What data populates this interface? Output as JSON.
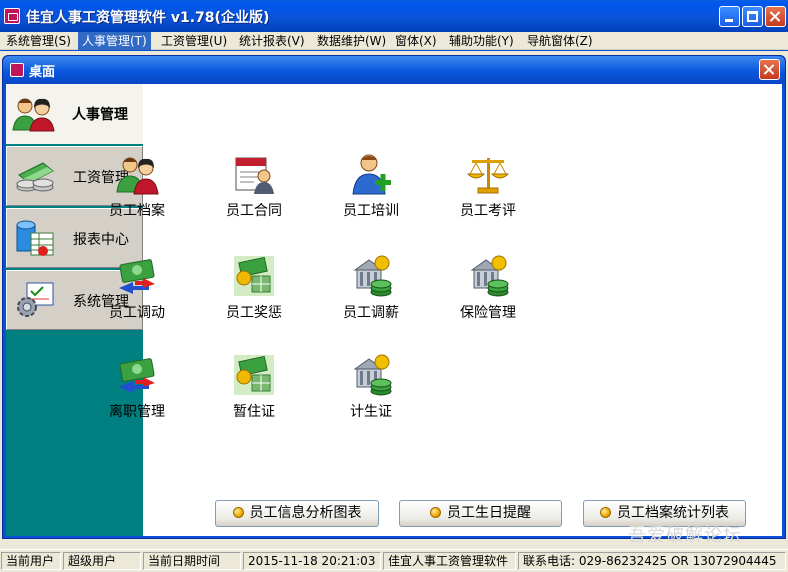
{
  "window": {
    "title": "佳宜人事工资管理软件  v1.78(企业版)"
  },
  "menu": [
    {
      "label": "系统管理(S)",
      "active": false
    },
    {
      "label": "人事管理(T)",
      "active": true
    },
    {
      "label": "工资管理(U)",
      "active": false
    },
    {
      "label": "统计报表(V)",
      "active": false
    },
    {
      "label": "数据维护(W)",
      "active": false
    },
    {
      "label": "窗体(X)",
      "active": false
    },
    {
      "label": "辅助功能(Y)",
      "active": false
    },
    {
      "label": "导航窗体(Z)",
      "active": false
    }
  ],
  "desktop": {
    "title": "桌面"
  },
  "nav": {
    "items": [
      {
        "label": "人事管理",
        "icon": "people-icon",
        "selected": true
      },
      {
        "label": "工资管理",
        "icon": "money-icon",
        "selected": false
      },
      {
        "label": "报表中心",
        "icon": "database-report-icon",
        "selected": false
      },
      {
        "label": "系统管理",
        "icon": "gear-checklist-icon",
        "selected": false
      }
    ]
  },
  "modules": [
    {
      "label": "员工档案",
      "icon": "people-icon"
    },
    {
      "label": "员工合同",
      "icon": "contract-icon"
    },
    {
      "label": "员工培训",
      "icon": "person-add-icon"
    },
    {
      "label": "员工考评",
      "icon": "scale-icon"
    },
    {
      "label": "员工调动",
      "icon": "transfer-icon"
    },
    {
      "label": "员工奖惩",
      "icon": "reward-icon"
    },
    {
      "label": "员工调薪",
      "icon": "coins-icon"
    },
    {
      "label": "保险管理",
      "icon": "coins-icon"
    },
    {
      "label": "离职管理",
      "icon": "transfer-icon"
    },
    {
      "label": "暂住证",
      "icon": "reward-icon"
    },
    {
      "label": "计生证",
      "icon": "coins-icon"
    }
  ],
  "reports": [
    {
      "label": "员工信息分析图表"
    },
    {
      "label": "员工生日提醒"
    },
    {
      "label": "员工档案统计列表"
    }
  ],
  "status": {
    "user_label": "当前用户",
    "user_value": "超级用户",
    "date_label": "当前日期时间",
    "date_value": "2015-11-18 20:21:03",
    "app_name": "佳宜人事工资管理软件",
    "phone": "联系电话:  029-86232425  OR  13072904445"
  },
  "watermark": "吾爱破解论坛",
  "colors": {
    "titlebar": "#0a52d6",
    "menu_active": "#316ac5",
    "nav_bg": "#008080",
    "button_face": "#ece9d8"
  }
}
